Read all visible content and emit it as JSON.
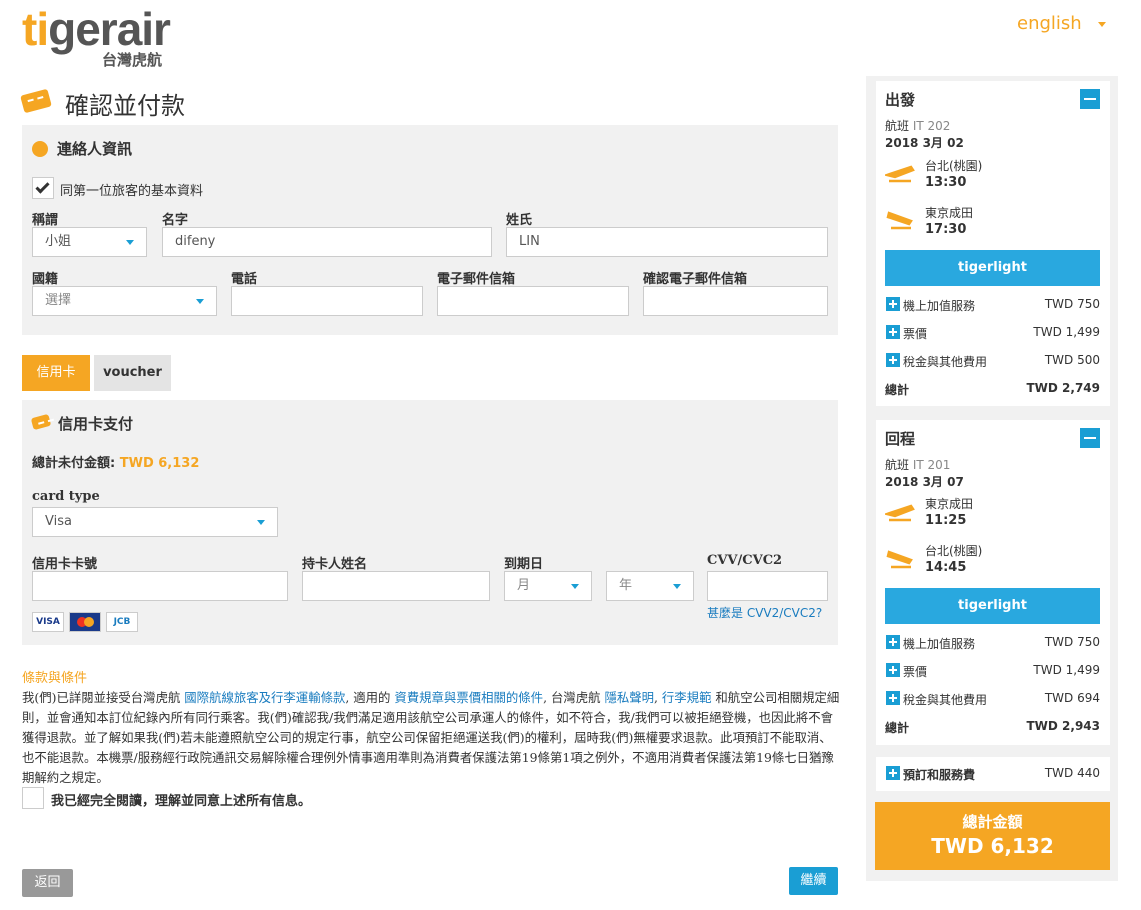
{
  "header": {
    "logo_main": "tigerair",
    "logo_sub": "台灣虎航",
    "language": "english",
    "language_icon": "chevron-down-icon"
  },
  "page": {
    "title": "確認並付款"
  },
  "contact": {
    "title": "連絡人資訊",
    "same_as_first_label": "同第一位旅客的基本資料",
    "same_as_first_checked": true,
    "title_label": "稱謂",
    "title_value": "小姐",
    "first_name_label": "名字",
    "first_name_value": "difeny",
    "last_name_label": "姓氏",
    "last_name_value": "LIN",
    "nationality_label": "國籍",
    "nationality_placeholder": "選擇",
    "phone_label": "電話",
    "phone_value": "",
    "email_label": "電子郵件信箱",
    "email_value": "",
    "email_confirm_label": "確認電子郵件信箱",
    "email_confirm_value": ""
  },
  "payment_tabs": [
    {
      "label": "信用卡",
      "active": true
    },
    {
      "label": "voucher",
      "active": false
    }
  ],
  "credit_card": {
    "title": "信用卡支付",
    "total_label": "總計未付金額: ",
    "total_value": "TWD 6,132",
    "card_type_label": "card type",
    "card_type_value": "Visa",
    "card_number_label": "信用卡卡號",
    "holder_label": "持卡人姓名",
    "expiry_label": "到期日",
    "month_placeholder": "月",
    "year_placeholder": "年",
    "cvv_label": "CVV/CVC2",
    "cvv_help_prefix": "甚麼是 ",
    "cvv_help_link": "CVV2/CVC2?",
    "card_logos": [
      "VISA",
      "MC",
      "JCB"
    ]
  },
  "terms": {
    "title": "條款與條件",
    "p1": "我(們)已詳閱並接受台灣虎航 ",
    "link1": "國際航線旅客及行李運輸條款",
    "p2": ", 適用的 ",
    "link2": "資費規章與票價相關的條件",
    "p3": ", 台灣虎航 ",
    "link3": "隱私聲明",
    "p4": ", ",
    "link4": "行李規範",
    "p5": " 和航空公司相關規定細則，並會通知本訂位紀錄內所有同行乘客。我(們)確認我/我們滿足適用該航空公司承運人的條件，如不符合，我/我們可以被拒絕登機，也因此將不會獲得退款。並了解如果我(們)若未能遵照航空公司的規定行事，航空公司保留拒絕運送我(們)的權利，屆時我(們)無權要求退款。此項預訂不能取消、也不能退款。本機票/服務經行政院通訊交易解除權合理例外情事適用準則為消費者保護法第19條第1項之例外，不適用消費者保護法第19條七日猶豫期解約之規定。",
    "agree_label": "我已經完全閱讀，理解並同意上述所有信息。"
  },
  "actions": {
    "back_label": "返回",
    "next_label": "繼續"
  },
  "sidebar": {
    "outbound": {
      "title": "出發",
      "flight_label": "航班 ",
      "flight_no": "IT 202",
      "date": "2018 3月 02",
      "from": "台北(桃園)",
      "dep_time": "13:30",
      "to": "東京成田",
      "arr_time": "17:30",
      "fare": "tigerlight",
      "rows": [
        {
          "label": "機上加值服務",
          "value": "TWD 750"
        },
        {
          "label": "票價",
          "value": "TWD 1,499"
        },
        {
          "label": "稅金與其他費用",
          "value": "TWD 500"
        }
      ],
      "total_label": "總計",
      "total_value": "TWD 2,749"
    },
    "inbound": {
      "title": "回程",
      "flight_label": "航班 ",
      "flight_no": "IT 201",
      "date": "2018 3月 07",
      "from": "東京成田",
      "dep_time": "11:25",
      "to": "台北(桃園)",
      "arr_time": "14:45",
      "fare": "tigerlight",
      "rows": [
        {
          "label": "機上加值服務",
          "value": "TWD 750"
        },
        {
          "label": "票價",
          "value": "TWD 1,499"
        },
        {
          "label": "稅金與其他費用",
          "value": "TWD 694"
        }
      ],
      "total_label": "總計",
      "total_value": "TWD 2,943"
    },
    "booking_fee": {
      "label": "預訂和服務費",
      "value": "TWD 440"
    },
    "grand_total": {
      "label": "總計金額",
      "value": "TWD 6,132"
    }
  },
  "colors": {
    "accent": "#f5a623",
    "link": "#1a7cbf",
    "button_blue": "#1a9ed4",
    "panel_bg": "#f1f1f1"
  }
}
